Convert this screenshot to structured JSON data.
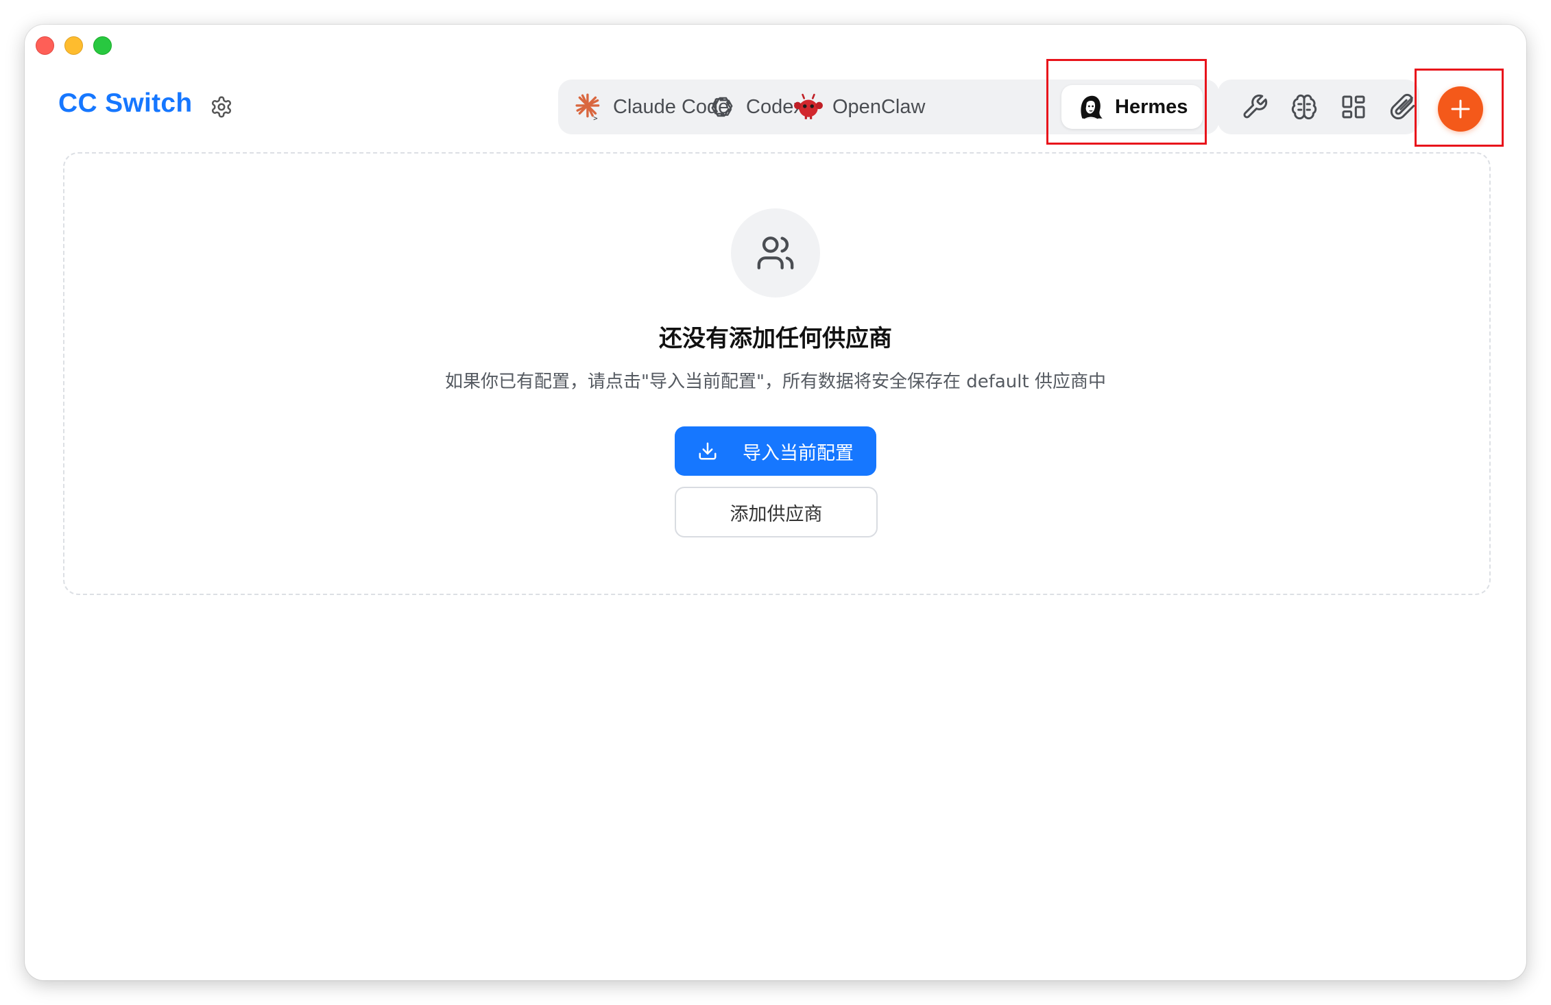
{
  "window": {
    "buttons": [
      "close",
      "minimize",
      "maximize"
    ]
  },
  "brand": {
    "title": "CC Switch",
    "settings_icon": "gear-icon"
  },
  "tabs": [
    {
      "label": "Claude Code",
      "icon": "claude-icon",
      "active": false
    },
    {
      "label": "Codex",
      "icon": "openai-icon",
      "active": false
    },
    {
      "label": "OpenClaw",
      "icon": "openclaw-icon",
      "active": false
    },
    {
      "label": "Hermes",
      "icon": "hermes-icon",
      "active": true
    }
  ],
  "toolbar": {
    "items": [
      "wrench-icon",
      "brain-icon",
      "grid-icon",
      "paperclip-icon"
    ]
  },
  "add_button": {
    "icon": "plus-icon",
    "color": "#f4591a"
  },
  "empty_state": {
    "icon": "users-icon",
    "title": "还没有添加任何供应商",
    "description": "如果你已有配置，请点击\"导入当前配置\"，所有数据将安全保存在 default 供应商中",
    "import_label": "导入当前配置",
    "add_label": "添加供应商"
  },
  "colors": {
    "accent": "#1677ff",
    "add": "#f4591a",
    "highlight": "#e8131b"
  }
}
